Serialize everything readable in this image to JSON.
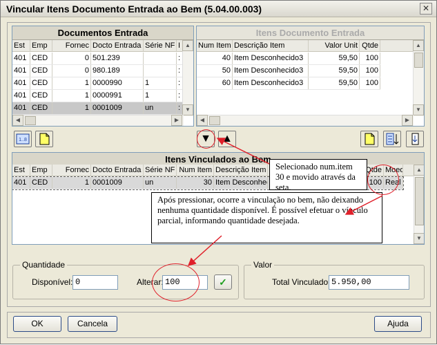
{
  "window": {
    "title": "Vincular Itens Documento Entrada ao Bem (5.04.00.003)",
    "close_glyph": "✕"
  },
  "docs": {
    "title": "Documentos Entrada",
    "columns": [
      "Est",
      "Emp",
      "Fornec",
      "Docto Entrada",
      "Série NF",
      "I"
    ],
    "rows": [
      [
        "401",
        "CED",
        "0",
        "501.239",
        "",
        ":"
      ],
      [
        "401",
        "CED",
        "0",
        "980.189",
        "",
        ":"
      ],
      [
        "401",
        "CED",
        "1",
        "0000990",
        "1",
        ":"
      ],
      [
        "401",
        "CED",
        "1",
        "0000991",
        "1",
        ":"
      ],
      [
        "401",
        "CED",
        "1",
        "0001009",
        "un",
        ":"
      ]
    ]
  },
  "itens": {
    "title": "Itens Documento Entrada",
    "columns": [
      "Num Item",
      "Descrição Item",
      "Valor Unit",
      "Qtde"
    ],
    "rows": [
      [
        "40",
        "Item Desconhecido3",
        "59,50",
        "100"
      ],
      [
        "50",
        "Item Desconhecido3",
        "59,50",
        "100"
      ],
      [
        "60",
        "Item Desconhecido3",
        "59,50",
        "100"
      ]
    ]
  },
  "vinc": {
    "title": "Itens Vinculados ao Bem",
    "columns": [
      "Est",
      "Emp",
      "Fornec",
      "Docto Entrada",
      "Série NF",
      "Num Item",
      "Descrição Item",
      "Qtde",
      "Moed"
    ],
    "rows": [
      [
        "401",
        "CED",
        "1",
        "0001009",
        "un",
        "30",
        "Item Desconhec",
        "100",
        "Real"
      ]
    ]
  },
  "quantidade": {
    "legend": "Quantidade",
    "disponivel_label": "Disponível:",
    "disponivel_value": "0",
    "alterar_label": "Alterar:",
    "alterar_value": "100"
  },
  "valor": {
    "legend": "Valor",
    "total_label": "Total Vinculado:",
    "total_value": "5.950,00"
  },
  "buttons": {
    "ok": "OK",
    "cancela": "Cancela",
    "ajuda": "Ajuda",
    "down_arrow": "▼",
    "up_arrow": "▲",
    "ok_check": "✓"
  },
  "annotations": {
    "note1": "Selecionado num.item 30 e movido através da seta.",
    "note2": "Após pressionar, ocorre a vinculação no bem, não deixando nenhuma quantidade disponível. É possível efetuar o vínculo parcial, informando quantidade desejada."
  },
  "colors": {
    "annotation": "#e0202a",
    "selection": "#c8c8c8"
  }
}
